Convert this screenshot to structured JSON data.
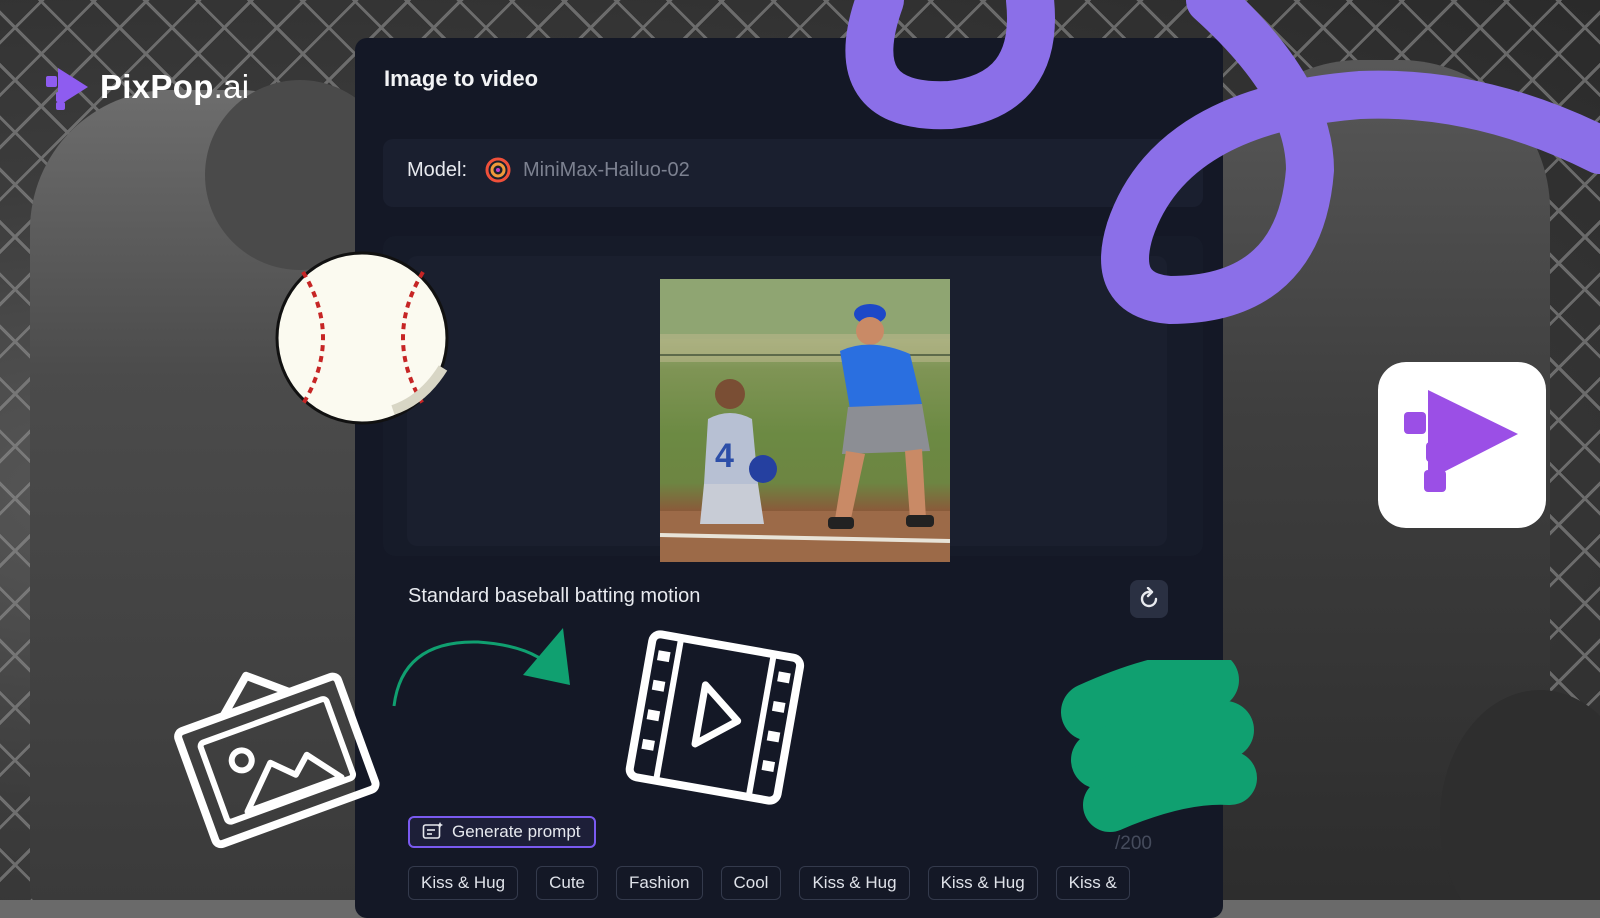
{
  "brand": {
    "name_bold": "PixPop",
    "name_light": ".ai"
  },
  "panel": {
    "title": "Image to video",
    "model_label": "Model:",
    "model_value": "MiniMax-Hailuo-02",
    "prompt_text": "Standard baseball batting motion",
    "char_count": "/200",
    "generate_label": "Generate prompt",
    "chips": [
      "Kiss & Hug",
      "Cute",
      "Fashion",
      "Cool",
      "Kiss & Hug",
      "Kiss & Hug",
      "Kiss &"
    ]
  },
  "colors": {
    "panel_bg": "#141826",
    "accent_purple": "#8b6fe8",
    "accent_green": "#10a070",
    "button_border": "#7a5af0"
  },
  "icons": {
    "logo": "pixpop-logo-icon",
    "refresh": "refresh-icon",
    "generate": "sparkle-chat-icon",
    "model": "hailuo-swirl-icon"
  }
}
